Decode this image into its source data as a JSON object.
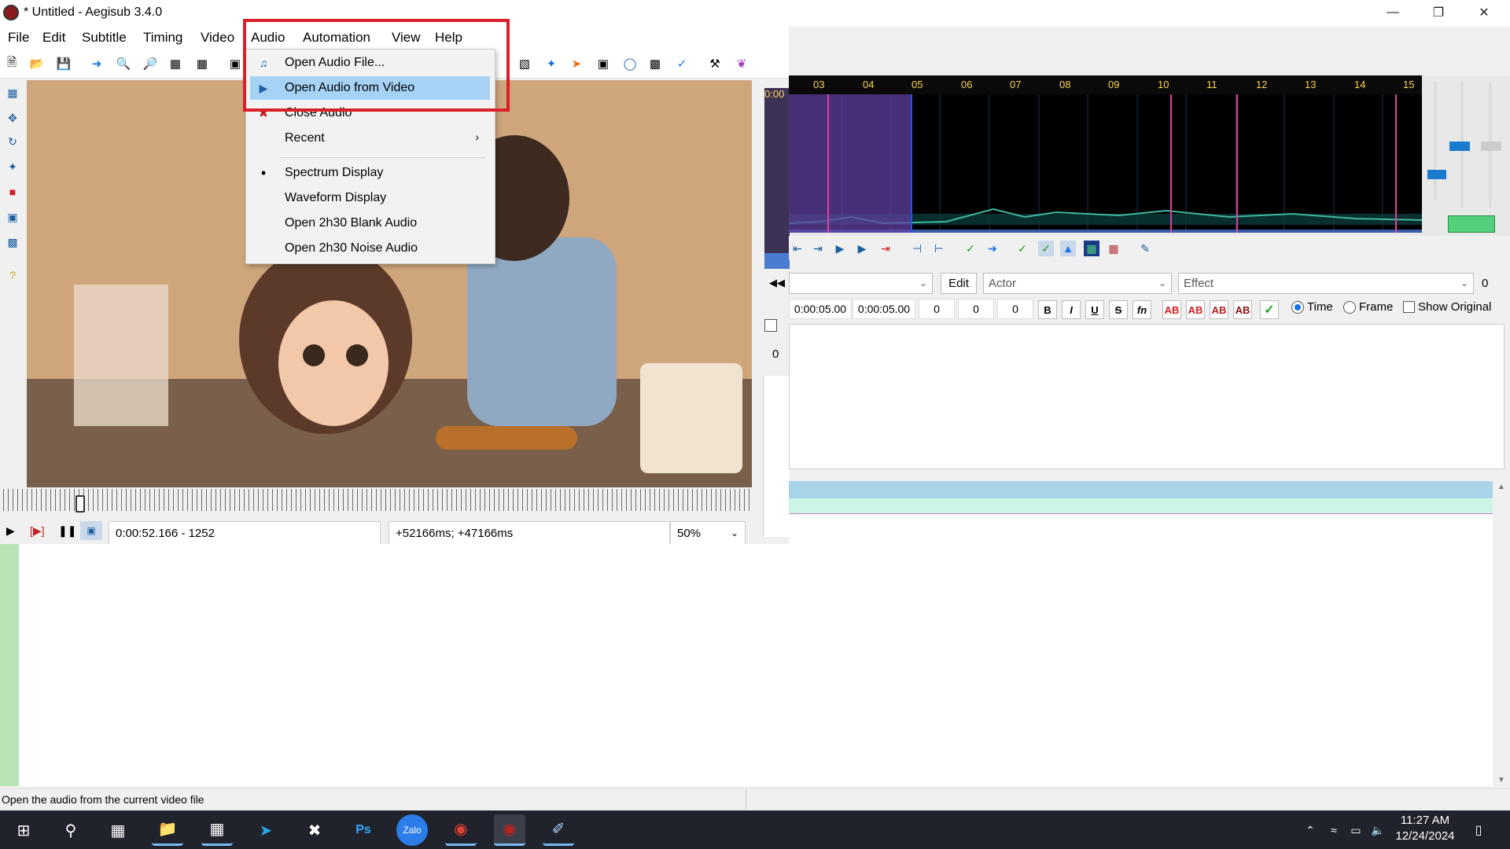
{
  "window": {
    "title": "* Untitled - Aegisub 3.4.0"
  },
  "menubar": {
    "items": [
      "File",
      "Edit",
      "Subtitle",
      "Timing",
      "Video",
      "Audio",
      "Automation",
      "View",
      "Help"
    ]
  },
  "audio_menu": {
    "items": [
      {
        "label": "Open Audio File...",
        "icon": "audio-file-icon"
      },
      {
        "label": "Open Audio from Video",
        "icon": "audio-video-icon",
        "highlighted": true
      },
      {
        "label": "Close Audio",
        "icon": "close-audio-icon"
      },
      {
        "label": "Recent",
        "submenu": true
      },
      {
        "label": "Spectrum Display",
        "checked": true
      },
      {
        "label": "Waveform Display"
      },
      {
        "label": "Open 2h30 Blank Audio"
      },
      {
        "label": "Open 2h30 Noise Audio"
      }
    ]
  },
  "video_controls": {
    "time": "0:00:52.166 - 1252",
    "offset": "+52166ms; +47166ms",
    "zoom": "50%"
  },
  "audio": {
    "timecode": "0:00",
    "ticks": [
      "03",
      "04",
      "05",
      "06",
      "07",
      "08",
      "09",
      "10",
      "11",
      "12",
      "13",
      "14",
      "15"
    ]
  },
  "edit": {
    "edit_button": "Edit",
    "actor_placeholder": "Actor",
    "effect_placeholder": "Effect",
    "layer": "0",
    "start": "0:00:05.00",
    "end": "0:00:05.00",
    "margin_l": "0",
    "margin_r": "0",
    "margin_v": "0",
    "bold": "B",
    "italic": "I",
    "underline": "U",
    "strike": "S",
    "fn": "fn",
    "ab_labels": [
      "AB",
      "AB",
      "AB",
      "AB"
    ],
    "time_label": "Time",
    "frame_label": "Frame",
    "show_original_label": "Show Original",
    "left_zero": "0",
    "time_mode": "Time"
  },
  "statusbar": {
    "text": "Open the audio from the current video file"
  },
  "taskbar": {
    "time": "11:27 AM",
    "date": "12/24/2024"
  },
  "colors": {
    "highlight": "#a6d2f5",
    "redbox": "#d9202a",
    "waveform_bg": "#000000",
    "timebar": "#ffd54f"
  }
}
